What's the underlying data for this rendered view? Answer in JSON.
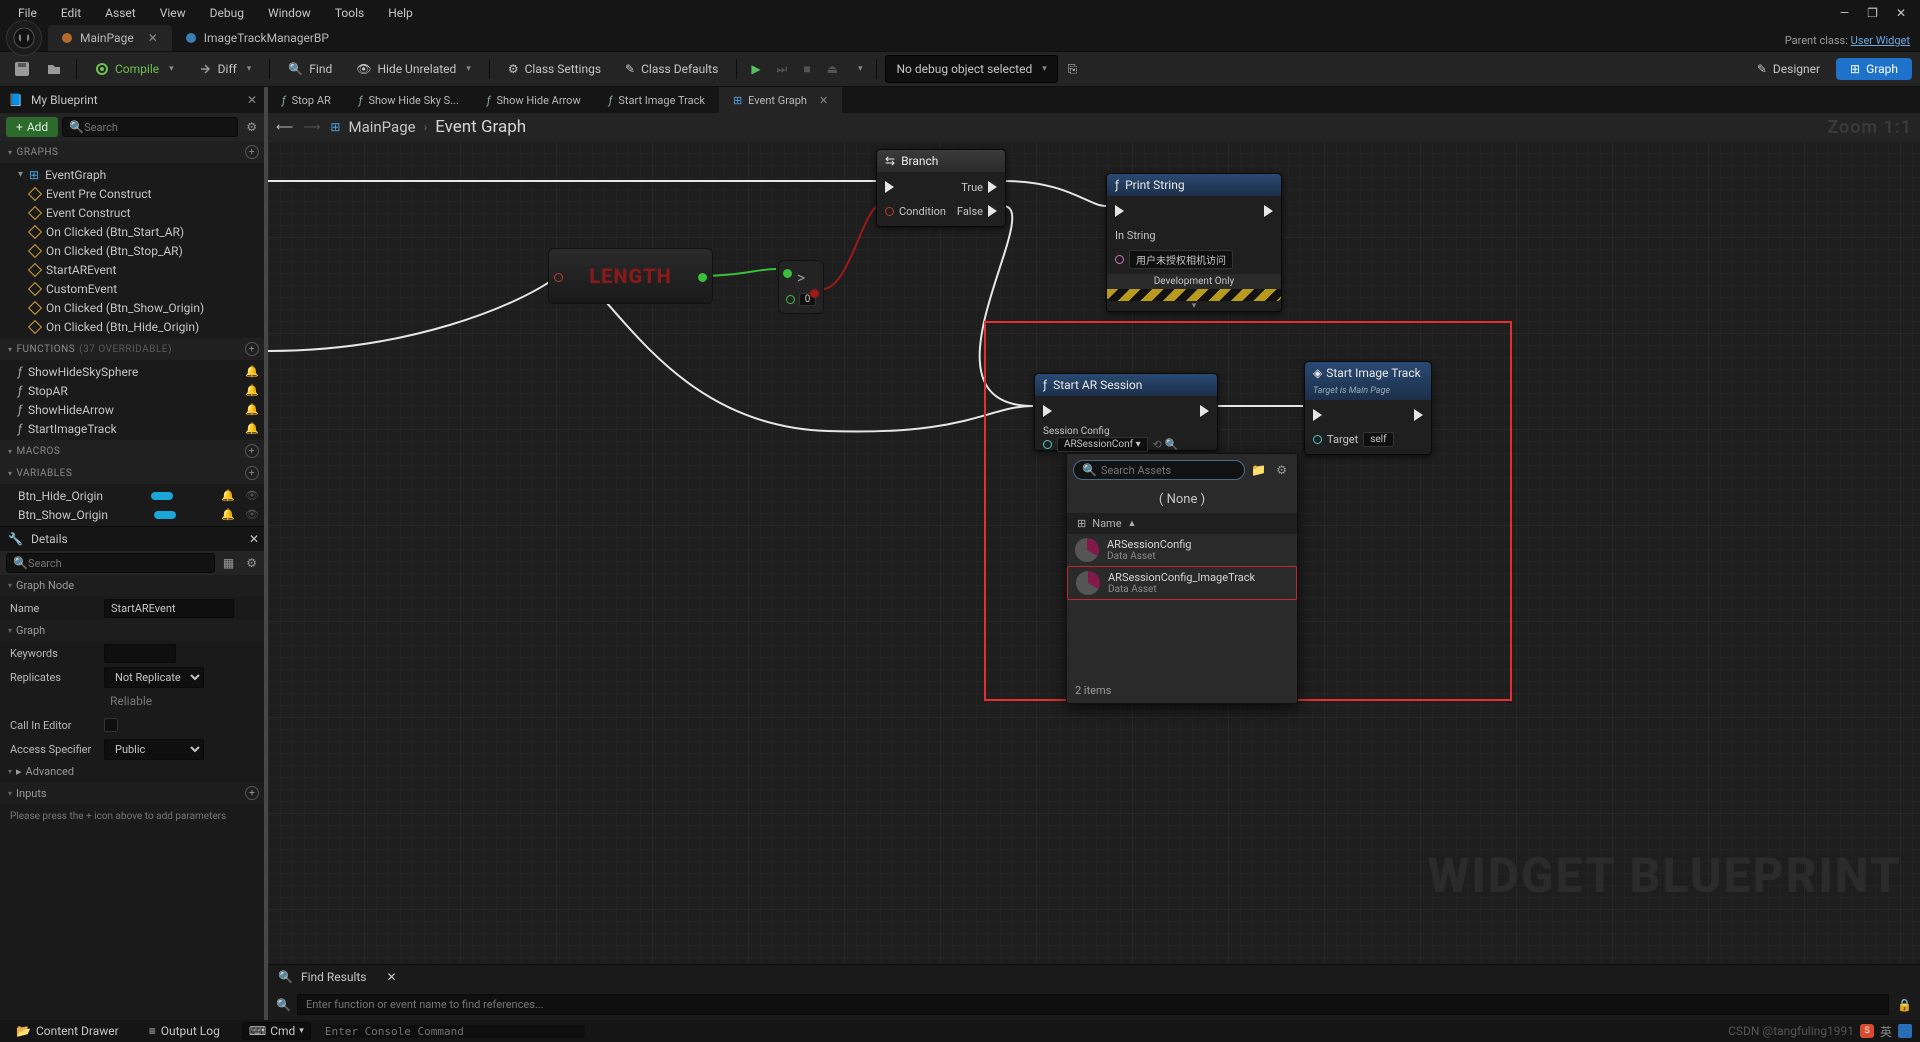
{
  "menu": [
    "File",
    "Edit",
    "Asset",
    "View",
    "Debug",
    "Window",
    "Tools",
    "Help"
  ],
  "docTabs": [
    {
      "label": "MainPage",
      "active": true,
      "close": true
    },
    {
      "label": "ImageTrackManagerBP",
      "active": false,
      "close": false
    }
  ],
  "parentClass": {
    "label": "Parent class:",
    "link": "User Widget"
  },
  "toolbar": {
    "compile": "Compile",
    "diff": "Diff",
    "find": "Find",
    "hideUnrelated": "Hide Unrelated",
    "classSettings": "Class Settings",
    "classDefaults": "Class Defaults",
    "debugSelect": "No debug object selected",
    "designer": "Designer",
    "graph": "Graph"
  },
  "panels": {
    "myBlueprint": "My Blueprint",
    "add": "Add",
    "searchPlaceholder": "Search"
  },
  "sections": {
    "graphs": "GRAPHS",
    "eventGraph": "EventGraph",
    "events": [
      "Event Pre Construct",
      "Event Construct",
      "On Clicked (Btn_Start_AR)",
      "On Clicked (Btn_Stop_AR)",
      "StartAREvent",
      "CustomEvent",
      "On Clicked (Btn_Show_Origin)",
      "On Clicked (Btn_Hide_Origin)"
    ],
    "functions": "FUNCTIONS",
    "functionsSuffix": "(37 OVERRIDABLE)",
    "fnList": [
      "ShowHideSkySphere",
      "StopAR",
      "ShowHideArrow",
      "StartImageTrack"
    ],
    "macros": "MACROS",
    "variables": "VARIABLES",
    "vars": [
      "Btn_Hide_Origin",
      "Btn_Show_Origin"
    ]
  },
  "details": {
    "title": "Details",
    "searchPlaceholder": "Search",
    "graphNode": "Graph Node",
    "nameLbl": "Name",
    "nameVal": "StartAREvent",
    "graph": "Graph",
    "keywordsLbl": "Keywords",
    "keywordsVal": "",
    "replicatesLbl": "Replicates",
    "replicatesVal": "Not Replicated",
    "reliable": "Reliable",
    "callInEditor": "Call In Editor",
    "accessSpecifier": "Access Specifier",
    "accessVal": "Public",
    "advanced": "Advanced",
    "inputs": "Inputs",
    "inputsHint": "Please press the + icon above to add parameters"
  },
  "graphTabs": [
    {
      "label": "Stop AR",
      "fx": true
    },
    {
      "label": "Show Hide Sky S...",
      "fx": true
    },
    {
      "label": "Show Hide Arrow",
      "fx": true
    },
    {
      "label": "Start Image Track",
      "fx": true
    },
    {
      "label": "Event Graph",
      "active": true,
      "eg": true,
      "close": true
    }
  ],
  "breadcrumb": {
    "main": "MainPage",
    "sub": "Event Graph"
  },
  "zoom": "Zoom 1:1",
  "nodes": {
    "branch": {
      "title": "Branch",
      "cond": "Condition",
      "t": "True",
      "f": "False"
    },
    "length": "LENGTH",
    "gtVal": "0",
    "print": {
      "title": "Print String",
      "inStr": "In String",
      "str": "用户未授权相机访问",
      "dev": "Development Only"
    },
    "startAR": {
      "title": "Start AR Session",
      "cfg": "Session Config",
      "cfgVal": "ARSessionConf"
    },
    "startTrack": {
      "title": "Start Image Track",
      "target": "Target is Main Page",
      "tLbl": "Target",
      "tVal": "self"
    }
  },
  "assetPicker": {
    "placeholder": "Search Assets",
    "none": "( None )",
    "nameCol": "Name",
    "items": [
      {
        "name": "ARSessionConfig",
        "type": "Data Asset"
      },
      {
        "name": "ARSessionConfig_ImageTrack",
        "type": "Data Asset",
        "hl": true
      }
    ],
    "count": "2 items"
  },
  "find": {
    "title": "Find Results",
    "placeholder": "Enter function or event name to find references..."
  },
  "bottom": {
    "drawer": "Content Drawer",
    "output": "Output Log",
    "cmd": "Cmd",
    "cmdPlaceholder": "Enter Console Command"
  },
  "watermark": "WIDGET BLUEPRINT",
  "csdn": "CSDN @tangfuling1991"
}
